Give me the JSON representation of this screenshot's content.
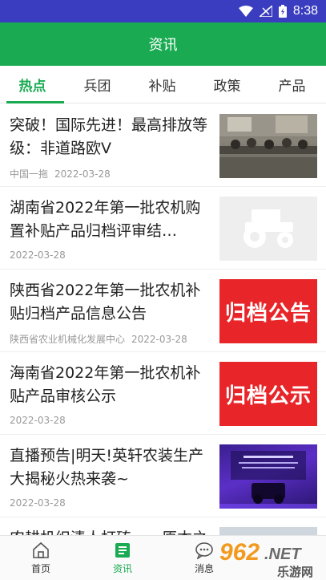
{
  "status_bar": {
    "time": "8:38",
    "icons": [
      "wifi-icon",
      "signal-icon",
      "battery-icon"
    ]
  },
  "app_bar": {
    "title": "资讯"
  },
  "tabs": [
    {
      "label": "热点",
      "active": true
    },
    {
      "label": "兵团",
      "active": false
    },
    {
      "label": "补贴",
      "active": false
    },
    {
      "label": "政策",
      "active": false
    },
    {
      "label": "产品",
      "active": false
    }
  ],
  "news": [
    {
      "title": "突破！国际先进！最高排放等级：非道路欧V",
      "source": "中国一拖",
      "date": "2022-03-28",
      "thumb": "meeting-photo"
    },
    {
      "title": "湖南省2022年第一批农机购置补贴产品归档评审结…",
      "source": "",
      "date": "2022-03-28",
      "thumb": "tractor-icon"
    },
    {
      "title": "陕西省2022年第一批农机补贴归档产品信息公告",
      "source": "陕西省农业机械化发展中心",
      "date": "2022-03-28",
      "thumb_text": "归档公告"
    },
    {
      "title": "海南省2022年第一批农机补贴产品审核公示",
      "source": "",
      "date": "2022-03-28",
      "thumb_text": "归档公示"
    },
    {
      "title": "直播预告|明天!英轩农装生产大揭秘火热来袭~",
      "source": "",
      "date": "2022-03-28",
      "thumb": "live-poster"
    },
    {
      "title": "农耕机织清人打砖一一原本之",
      "source": "",
      "date": "",
      "thumb": "partial"
    }
  ],
  "bottom_nav": [
    {
      "label": "首页",
      "icon": "home-icon",
      "active": false
    },
    {
      "label": "资讯",
      "icon": "news-icon",
      "active": true
    },
    {
      "label": "消息",
      "icon": "message-icon",
      "active": false
    }
  ],
  "watermark": {
    "brand": "962",
    "suffix": ".NET",
    "subtitle": "乐游网"
  },
  "colors": {
    "accent": "#1aab52",
    "status_bar": "#3a3dbf",
    "badge_red": "#e8262a"
  }
}
